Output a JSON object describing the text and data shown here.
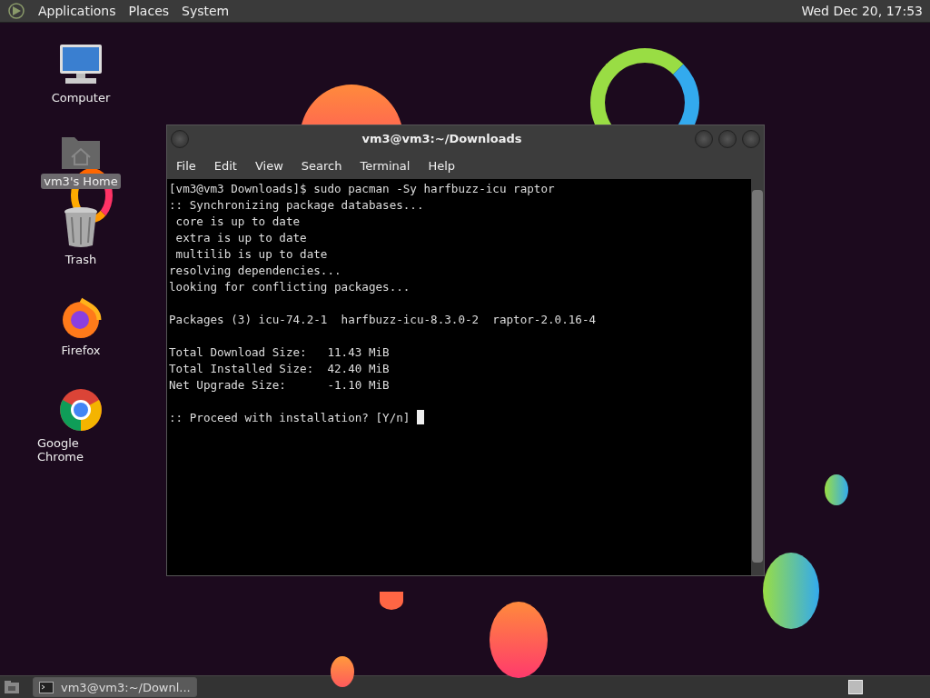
{
  "top_panel": {
    "menus": [
      "Applications",
      "Places",
      "System"
    ],
    "clock": "Wed Dec 20, 17:53"
  },
  "desktop_icons": [
    {
      "kind": "computer",
      "label": "Computer",
      "selected": false
    },
    {
      "kind": "home",
      "label": "vm3's Home",
      "selected": true
    },
    {
      "kind": "trash",
      "label": "Trash",
      "selected": false
    },
    {
      "kind": "firefox",
      "label": "Firefox",
      "selected": false
    },
    {
      "kind": "chrome",
      "label": "Google Chrome",
      "selected": false
    }
  ],
  "window": {
    "title": "vm3@vm3:~/Downloads",
    "menu": [
      "File",
      "Edit",
      "View",
      "Search",
      "Terminal",
      "Help"
    ],
    "terminal_blocks": [
      [
        "[vm3@vm3 Downloads]$ sudo pacman -Sy harfbuzz-icu raptor",
        ":: Synchronizing package databases...",
        " core is up to date",
        " extra is up to date",
        " multilib is up to date",
        "resolving dependencies...",
        "looking for conflicting packages..."
      ],
      [
        "Packages (3) icu-74.2-1  harfbuzz-icu-8.3.0-2  raptor-2.0.16-4"
      ],
      [
        "Total Download Size:   11.43 MiB",
        "Total Installed Size:  42.40 MiB",
        "Net Upgrade Size:      -1.10 MiB"
      ],
      [
        ":: Proceed with installation? [Y/n] "
      ]
    ]
  },
  "taskbar": {
    "tasks": [
      {
        "label": "vm3@vm3:~/Downl...",
        "selected": true
      }
    ]
  }
}
